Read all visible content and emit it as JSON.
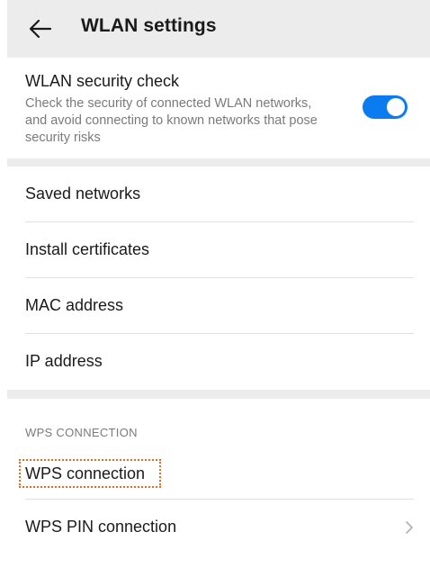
{
  "header": {
    "title": "WLAN settings",
    "back_icon": "back-arrow-icon"
  },
  "security_check": {
    "title": "WLAN security check",
    "description": "Check the security of connected WLAN networks, and avoid connecting to known networks that pose security risks",
    "toggle_on": true,
    "toggle_color": "#0a7cf0"
  },
  "network_items": [
    {
      "label": "Saved networks"
    },
    {
      "label": "Install certificates"
    },
    {
      "label": "MAC address"
    },
    {
      "label": "IP address"
    }
  ],
  "wps": {
    "section_header": "WPS CONNECTION",
    "items": [
      {
        "label": "WPS connection",
        "highlighted": true
      },
      {
        "label": "WPS PIN connection",
        "chevron_icon": "chevron-right-icon"
      }
    ],
    "highlight_color": "#e86a1c"
  },
  "colors": {
    "background_gray": "#ececec",
    "text_primary": "#1a1a1a",
    "text_secondary": "#7a7a7a"
  }
}
